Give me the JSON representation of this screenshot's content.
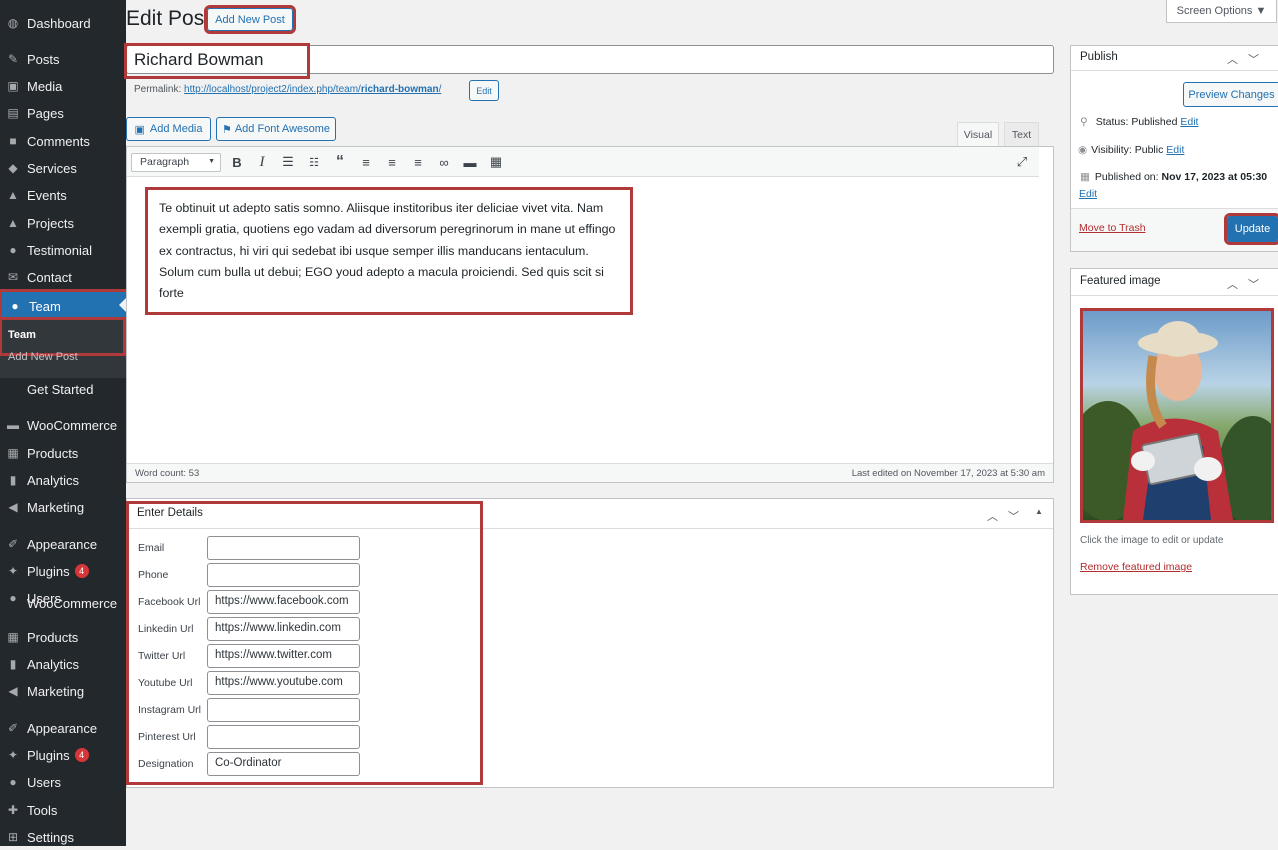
{
  "sidebar": {
    "items": [
      {
        "label": "Dashboard",
        "icon": "dashboard-icon",
        "glyph": "◍"
      },
      {
        "label": "Posts",
        "icon": "pin-icon",
        "glyph": "✎"
      },
      {
        "label": "Media",
        "icon": "media-icon",
        "glyph": "▣"
      },
      {
        "label": "Pages",
        "icon": "pages-icon",
        "glyph": "▤"
      },
      {
        "label": "Comments",
        "icon": "comment-icon",
        "glyph": "■"
      },
      {
        "label": "Services",
        "icon": "tag-icon",
        "glyph": "◆"
      },
      {
        "label": "Events",
        "icon": "grad-cap-icon",
        "glyph": "▲"
      },
      {
        "label": "Projects",
        "icon": "grad-cap-icon",
        "glyph": "▲"
      },
      {
        "label": "Testimonial",
        "icon": "user-icon",
        "glyph": "●"
      },
      {
        "label": "Contact",
        "icon": "mail-icon",
        "glyph": "✉"
      },
      {
        "label": "Team",
        "icon": "user-icon",
        "glyph": "●"
      },
      {
        "label": "Get Started",
        "icon": "",
        "glyph": ""
      },
      {
        "label": "WooCommerce",
        "icon": "woo-icon",
        "glyph": "▬"
      },
      {
        "label": "Products",
        "icon": "archive-icon",
        "glyph": "▦"
      },
      {
        "label": "Analytics",
        "icon": "bar-chart-icon",
        "glyph": "▮"
      },
      {
        "label": "Marketing",
        "icon": "megaphone-icon",
        "glyph": "◀"
      },
      {
        "label": "Appearance",
        "icon": "brush-icon",
        "glyph": "✐"
      },
      {
        "label": "Plugins",
        "icon": "plug-icon",
        "glyph": "✦",
        "badge": "4"
      },
      {
        "label": "Users",
        "icon": "user-icon",
        "glyph": "●"
      },
      {
        "label": "WooCommerce",
        "icon": "woo-icon",
        "glyph": ""
      },
      {
        "label": "Products",
        "icon": "archive-icon",
        "glyph": "▦"
      },
      {
        "label": "Analytics",
        "icon": "bar-chart-icon",
        "glyph": "▮"
      },
      {
        "label": "Marketing",
        "icon": "megaphone-icon",
        "glyph": "◀"
      },
      {
        "label": "Appearance",
        "icon": "brush-icon",
        "glyph": "✐"
      },
      {
        "label": "Plugins",
        "icon": "plug-icon",
        "glyph": "✦",
        "badge": "4"
      },
      {
        "label": "Users",
        "icon": "user-icon",
        "glyph": "●"
      },
      {
        "label": "Tools",
        "icon": "wrench-icon",
        "glyph": "✚"
      },
      {
        "label": "Settings",
        "icon": "settings-icon",
        "glyph": "⊞"
      }
    ],
    "submenu": {
      "current": "Team",
      "add_new": "Add New Post"
    }
  },
  "header": {
    "title": "Edit Post",
    "add_new": "Add New Post",
    "screen_options": "Screen Options ▼"
  },
  "post": {
    "title": "Richard Bowman",
    "permalink_label": "Permalink:",
    "permalink_base": "http://localhost/project2/index.php/team/",
    "permalink_slug": "richard-bowman",
    "permalink_end": "/",
    "permalink_edit": "Edit"
  },
  "editor": {
    "add_media": "Add Media",
    "add_font": "Add Font Awesome",
    "tab_visual": "Visual",
    "tab_text": "Text",
    "format": "Paragraph",
    "content": "Te obtinuit ut adepto satis somno. Aliisque institoribus iter deliciae vivet vita. Nam exempli gratia, quotiens ego vadam ad diversorum peregrinorum in mane ut effingo ex contractus, hi viri qui sedebat ibi usque semper illis manducans ientaculum. Solum cum bulla ut debui; EGO youd adepto a macula proiciendi. Sed quis scit si forte",
    "word_count": "Word count: 53",
    "last_edited": "Last edited on November 17, 2023 at 5:30 am"
  },
  "details": {
    "title": "Enter Details",
    "fields": [
      {
        "label": "Email",
        "value": ""
      },
      {
        "label": "Phone",
        "value": ""
      },
      {
        "label": "Facebook Url",
        "value": "https://www.facebook.com"
      },
      {
        "label": "Linkedin Url",
        "value": "https://www.linkedin.com"
      },
      {
        "label": "Twitter Url",
        "value": "https://www.twitter.com"
      },
      {
        "label": "Youtube Url",
        "value": "https://www.youtube.com"
      },
      {
        "label": "Instagram Url",
        "value": ""
      },
      {
        "label": "Pinterest Url",
        "value": ""
      },
      {
        "label": "Designation",
        "value": "Co-Ordinator"
      }
    ]
  },
  "publish": {
    "title": "Publish",
    "preview": "Preview Changes",
    "status_label": "Status:",
    "status_value": "Published",
    "visibility_label": "Visibility:",
    "visibility_value": "Public",
    "published_label": "Published on:",
    "published_value": "Nov 17, 2023 at 05:30",
    "edit": "Edit",
    "trash": "Move to Trash",
    "update": "Update"
  },
  "featured": {
    "title": "Featured image",
    "hint": "Click the image to edit or update",
    "remove": "Remove featured image"
  },
  "colors": {
    "accent": "#2271b1",
    "highlight": "#b03a3a",
    "sidebar": "#23282d"
  }
}
